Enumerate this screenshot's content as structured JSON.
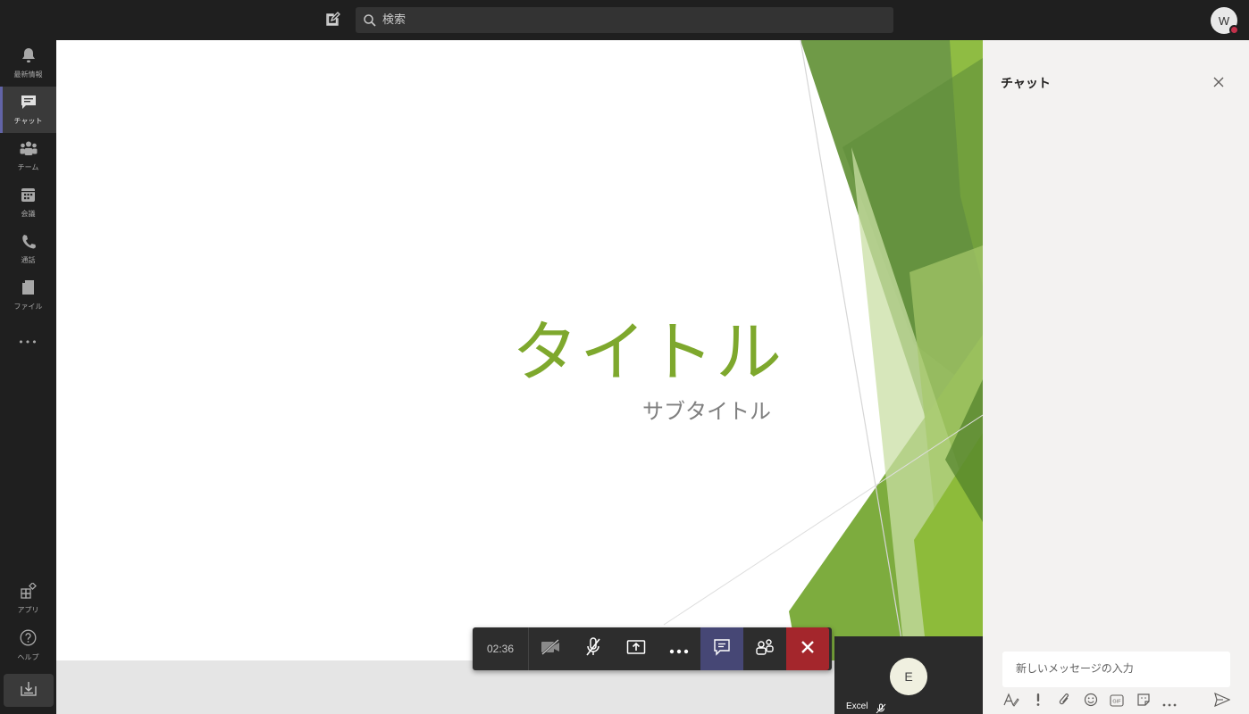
{
  "topbar": {
    "search_placeholder": "検索",
    "avatar_initial": "W"
  },
  "rail": {
    "items": [
      {
        "label": "最新情報",
        "icon": "bell-icon"
      },
      {
        "label": "チャット",
        "icon": "chat-icon",
        "active": true
      },
      {
        "label": "チーム",
        "icon": "teams-icon"
      },
      {
        "label": "会議",
        "icon": "calendar-icon"
      },
      {
        "label": "通話",
        "icon": "phone-icon"
      },
      {
        "label": "ファイル",
        "icon": "file-icon"
      }
    ],
    "more": "•••",
    "apps_label": "アプリ",
    "help_label": "ヘルプ"
  },
  "slide": {
    "title": "タイトル",
    "subtitle": "サブタイトル",
    "accent_color": "#7ea82d"
  },
  "participant": {
    "initial": "E",
    "name": "Excel"
  },
  "controls": {
    "timer": "02:36",
    "hangup_color": "#a4262c"
  },
  "chat": {
    "title": "チャット",
    "input_placeholder": "新しいメッセージの入力",
    "tools": [
      "format-icon",
      "important-icon",
      "attach-icon",
      "emoji-icon",
      "gif-icon",
      "sticker-icon",
      "more-icon"
    ]
  }
}
